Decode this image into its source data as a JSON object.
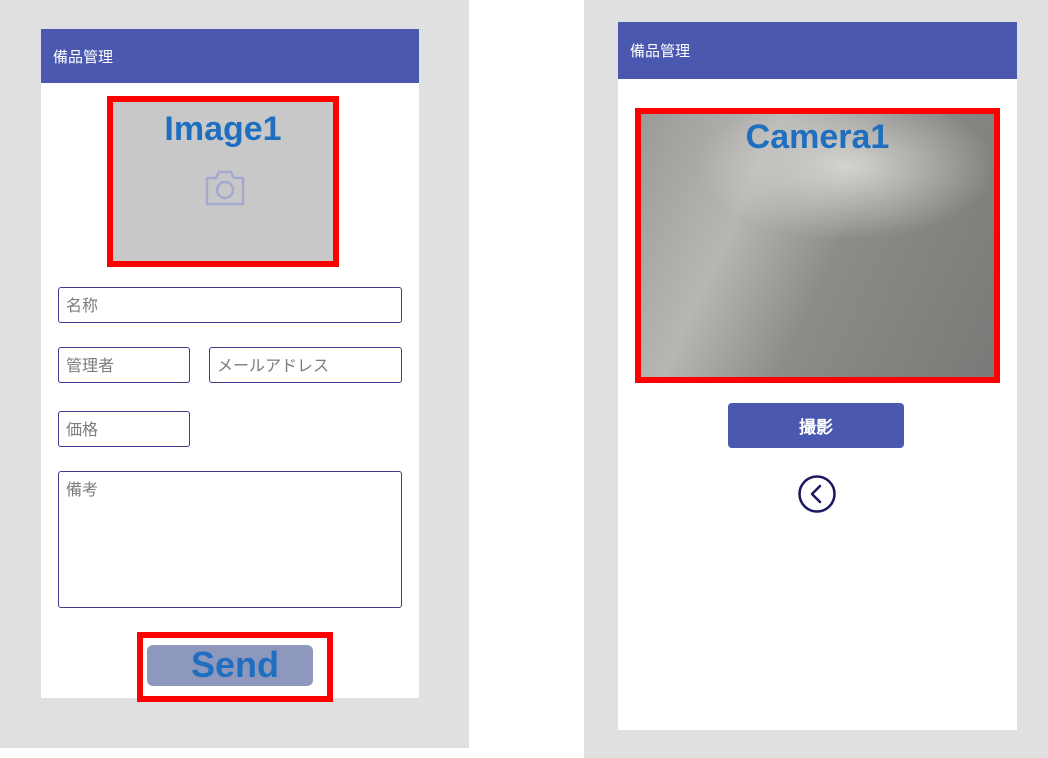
{
  "left_screen": {
    "header_title": "備品管理",
    "image_control_label": "Image1",
    "image_icon": "camera-icon",
    "name_placeholder": "名称",
    "manager_placeholder": "管理者",
    "email_placeholder": "メールアドレス",
    "price_placeholder": "価格",
    "notes_placeholder": "備考",
    "send_label": "Send"
  },
  "right_screen": {
    "header_title": "備品管理",
    "camera_control_label": "Camera1",
    "capture_label": "撮影",
    "back_icon": "chevron-left-circle-icon"
  },
  "colors": {
    "header": "#4a58b0",
    "highlight_border": "#ff0000",
    "overlay_label": "#1e6fbf",
    "send_button": "#8e98bd",
    "field_border": "#3c3a8f"
  }
}
